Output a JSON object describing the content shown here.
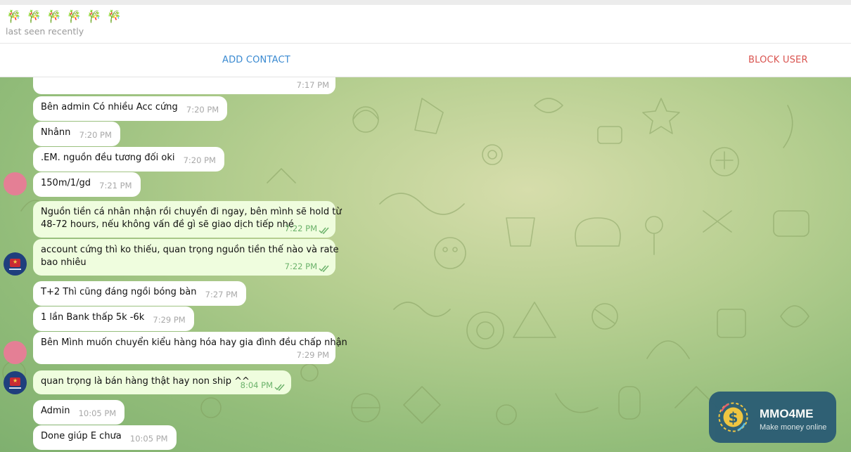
{
  "contact": {
    "name": "🎋 🎋 🎋 🎋 🎋 🎋",
    "status": "last seen recently"
  },
  "actions": {
    "add_contact": "ADD CONTACT",
    "block_user": "BLOCK USER"
  },
  "messages": [
    {
      "text": "",
      "time": "7:17 PM"
    },
    {
      "text": "Bên  admin Có nhiều  Acc cứng",
      "time": "7:20 PM"
    },
    {
      "text": "Nhânn",
      "time": "7:20 PM"
    },
    {
      "text": ".EM. nguồn   đều tương đối oki",
      "time": "7:20 PM"
    },
    {
      "text": "150m/1/gd",
      "time": "7:21 PM"
    },
    {
      "line1": "Nguồn tiền cá nhân nhận rồi chuyển đi ngay, bên mình sẽ hold từ",
      "line2": "48-72 hours, nếu không vấn đề gì sẽ giao dịch tiếp nhé",
      "time": "7:22 PM"
    },
    {
      "line1": "account cứng thì ko thiếu, quan trọng nguồn tiền thế nào và rate",
      "line2": "bao nhiêu",
      "time": "7:22 PM"
    },
    {
      "text": "T+2  Thì cũng đáng  ngồi bóng bàn",
      "time": "7:27 PM"
    },
    {
      "text": "1 lần Bank thấp 5k -6k",
      "time": "7:29 PM"
    },
    {
      "text": "Bên Mình muốn chuyển kiểu hàng hóa hay  gia đình đều  chấp nhận",
      "time": "7:29 PM"
    },
    {
      "text": "quan trọng là bán hàng thật hay non ship ^^",
      "time": "8:04 PM"
    },
    {
      "text": "Admin",
      "time": "10:05 PM"
    },
    {
      "text": "Done giúp E chưa",
      "time": "10:05 PM"
    }
  ],
  "watermark": {
    "brand": "MMO4ME",
    "tagline": "Make money online"
  },
  "colors": {
    "accent": "#3a8ad1",
    "danger": "#d9534f",
    "outgoing_bubble": "#effdde",
    "read_check": "#6cb26b"
  }
}
